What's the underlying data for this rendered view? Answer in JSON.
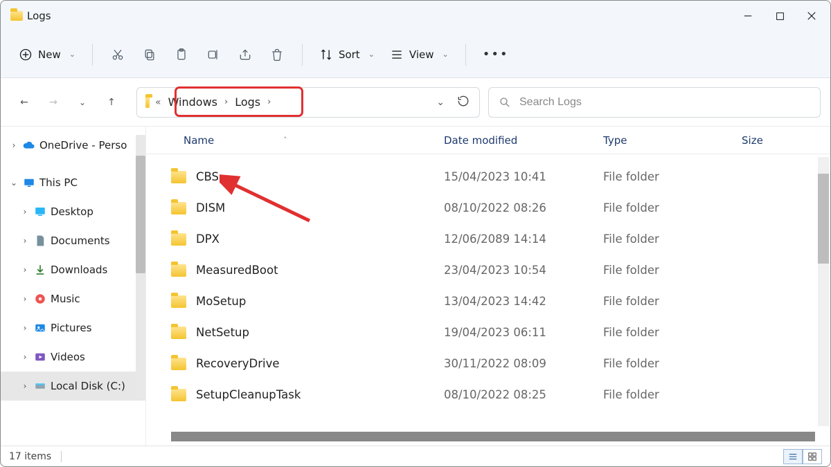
{
  "window": {
    "title": "Logs"
  },
  "toolbar": {
    "new_label": "New",
    "sort_label": "Sort",
    "view_label": "View"
  },
  "address": {
    "crumb1": "Windows",
    "crumb2": "Logs"
  },
  "search": {
    "placeholder": "Search Logs"
  },
  "sidebar": {
    "items": [
      {
        "label": "OneDrive - Perso",
        "icon": "cloud",
        "depth": 0,
        "expander": "›"
      },
      {
        "label": "This PC",
        "icon": "pc",
        "depth": 0,
        "expander": "v"
      },
      {
        "label": "Desktop",
        "icon": "desktop",
        "depth": 1,
        "expander": "›"
      },
      {
        "label": "Documents",
        "icon": "documents",
        "depth": 1,
        "expander": "›"
      },
      {
        "label": "Downloads",
        "icon": "downloads",
        "depth": 1,
        "expander": "›"
      },
      {
        "label": "Music",
        "icon": "music",
        "depth": 1,
        "expander": "›"
      },
      {
        "label": "Pictures",
        "icon": "pictures",
        "depth": 1,
        "expander": "›"
      },
      {
        "label": "Videos",
        "icon": "videos",
        "depth": 1,
        "expander": "›"
      },
      {
        "label": "Local Disk (C:)",
        "icon": "disk",
        "depth": 1,
        "expander": "›",
        "selected": true
      }
    ]
  },
  "columns": {
    "name": "Name",
    "date": "Date modified",
    "type": "Type",
    "size": "Size"
  },
  "rows": [
    {
      "name": "CBS",
      "date": "15/04/2023 10:41",
      "type": "File folder"
    },
    {
      "name": "DISM",
      "date": "08/10/2022 08:26",
      "type": "File folder"
    },
    {
      "name": "DPX",
      "date": "12/06/2089 14:14",
      "type": "File folder"
    },
    {
      "name": "MeasuredBoot",
      "date": "23/04/2023 10:54",
      "type": "File folder"
    },
    {
      "name": "MoSetup",
      "date": "13/04/2023 14:42",
      "type": "File folder"
    },
    {
      "name": "NetSetup",
      "date": "19/04/2023 06:11",
      "type": "File folder"
    },
    {
      "name": "RecoveryDrive",
      "date": "30/11/2022 08:09",
      "type": "File folder"
    },
    {
      "name": "SetupCleanupTask",
      "date": "08/10/2022 08:25",
      "type": "File folder"
    }
  ],
  "status": {
    "count": "17 items"
  }
}
